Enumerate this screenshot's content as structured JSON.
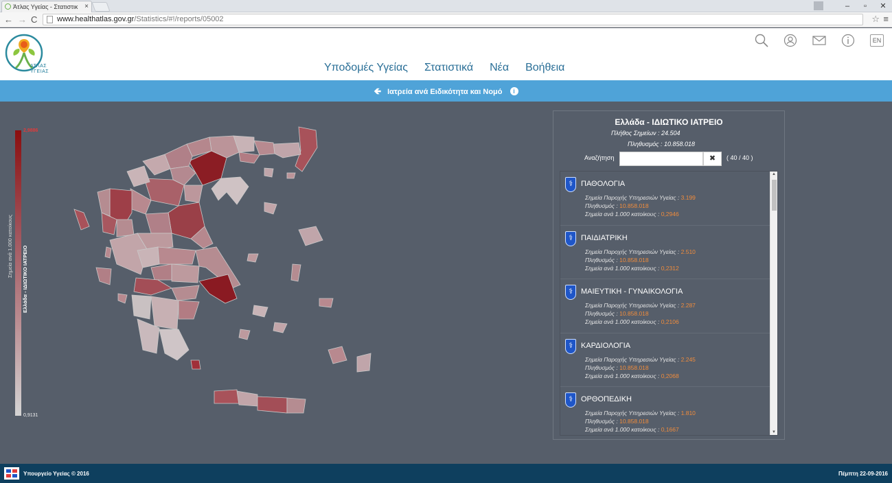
{
  "browser": {
    "tab_title": "Άτλας Υγείας - Στατιστικ",
    "tab_close": "×",
    "url_host": "www.healthatlas.gov.gr",
    "url_path": "/Statistics/#!/reports/05002",
    "win_min": "–",
    "win_max": "▫",
    "win_close": "✕"
  },
  "header": {
    "logo_text_line1": "ΑΤΛΑΣ",
    "logo_text_line2": "ΥΓΕΙΑΣ",
    "nav": [
      "Υποδομές Υγείας",
      "Στατιστικά",
      "Νέα",
      "Βοήθεια"
    ],
    "lang": "EN"
  },
  "title_bar": {
    "text": "Ιατρεία ανά Ειδικότητα και Νομό"
  },
  "legend": {
    "max": "2,9886",
    "min": "0,9131",
    "label_metric": "Σημεία ανά 1.000 κατοίκους",
    "label_series": "Ελλάδα - ΙΔΙΩΤΙΚΟ ΙΑΤΡΕΙΟ"
  },
  "panel": {
    "title": "Ελλάδα - ΙΔΙΩΤΙΚΟ ΙΑΤΡΕΙΟ",
    "points_line": "Πλήθος Σημείων :  24.504",
    "population_line": "Πληθυσμός :  10.858.018",
    "search_label": "Αναζήτηση",
    "search_value": "",
    "search_clear": "✖",
    "count": "( 40 / 40 )",
    "row_label_points": "Σημεία Παροχής Υπηρεσιών Υγείας  :",
    "row_label_pop": "Πληθυσμός  :",
    "row_label_per": "Σημεία ανά 1.000 κατοίκους  :",
    "items": [
      {
        "title": "ΠΑΘΟΛΟΓΙΑ",
        "points": "3.199",
        "population": "10.858.018",
        "per": "0,2946"
      },
      {
        "title": "ΠΑΙΔΙΑΤΡΙΚΗ",
        "points": "2.510",
        "population": "10.858.018",
        "per": "0,2312"
      },
      {
        "title": "ΜΑΙΕΥΤΙΚΗ - ΓΥΝΑΙΚΟΛΟΓΙΑ",
        "points": "2.287",
        "population": "10.858.018",
        "per": "0,2106"
      },
      {
        "title": "ΚΑΡΔΙΟΛΟΓΙΑ",
        "points": "2.245",
        "population": "10.858.018",
        "per": "0,2068"
      },
      {
        "title": "ΟΡΘΟΠΕΔΙΚΗ",
        "points": "1.810",
        "population": "10.858.018",
        "per": "0,1667"
      }
    ]
  },
  "footer": {
    "left": "Υπουργείο Υγείας © 2016",
    "right": "Πέμπτη 22-09-2016"
  }
}
